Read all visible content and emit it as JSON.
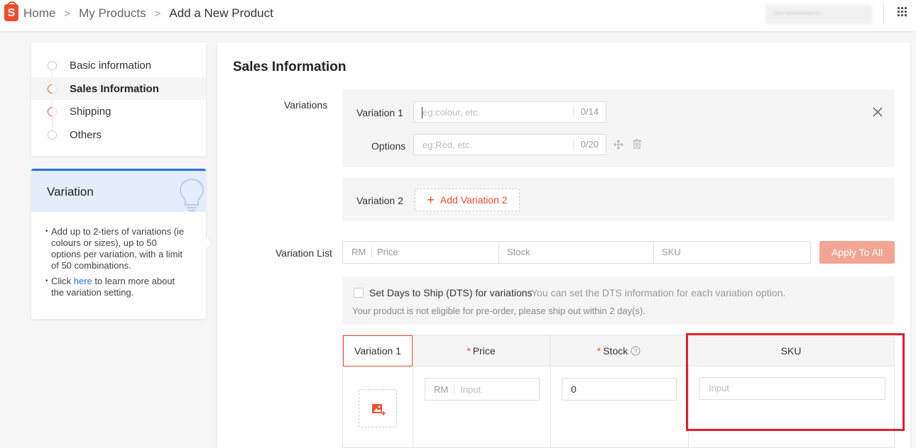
{
  "header": {
    "logo_letter": "S",
    "breadcrumb": [
      "Home",
      "My Products",
      "Add a New Product"
    ],
    "separator": ">",
    "user_blurred": "•••• ••••••••••• ••"
  },
  "nav": {
    "items": [
      {
        "label": "Basic information",
        "state": "empty"
      },
      {
        "label": "Sales Information",
        "state": "partial",
        "active": true
      },
      {
        "label": "Shipping",
        "state": "partial"
      },
      {
        "label": "Others",
        "state": "empty"
      }
    ]
  },
  "tip": {
    "title": "Variation",
    "bullet1": "Add up to 2-tiers of variations (ie colours or sizes), up to 50 options per variation, with a limit of 50 combinations.",
    "bullet2_pre": "Click ",
    "bullet2_link": "here",
    "bullet2_post": " to learn more about the variation setting."
  },
  "sales": {
    "title": "Sales Information",
    "variations_label": "Variations",
    "variation1": {
      "label": "Variation 1",
      "placeholder": "eg:colour, etc.",
      "counter": "0/14"
    },
    "options": {
      "label": "Options",
      "placeholder": "eg:Red, etc.",
      "counter": "0/20"
    },
    "variation2": {
      "label": "Variation 2",
      "add_button": "Add Variation 2"
    },
    "variation_list": {
      "label": "Variation List",
      "currency": "RM",
      "price_placeholder": "Price",
      "stock_placeholder": "Stock",
      "sku_placeholder": "SKU",
      "apply_button": "Apply To All"
    },
    "dts": {
      "label": "Set Days to Ship (DTS) for variations",
      "hint": "You can set the DTS information for each variation option.",
      "note": "Your product is not eligible for pre-order, please ship out within 2 day(s)."
    },
    "table": {
      "columns": [
        "Variation 1",
        "Price",
        "Stock",
        "SKU"
      ],
      "required_mark": "*",
      "row": {
        "currency": "RM",
        "price_placeholder": "Input",
        "stock_value": "0",
        "sku_placeholder": "Input"
      }
    }
  },
  "colors": {
    "brand": "#ee4d2d",
    "link": "#2673dd",
    "highlight": "#e0202a"
  }
}
